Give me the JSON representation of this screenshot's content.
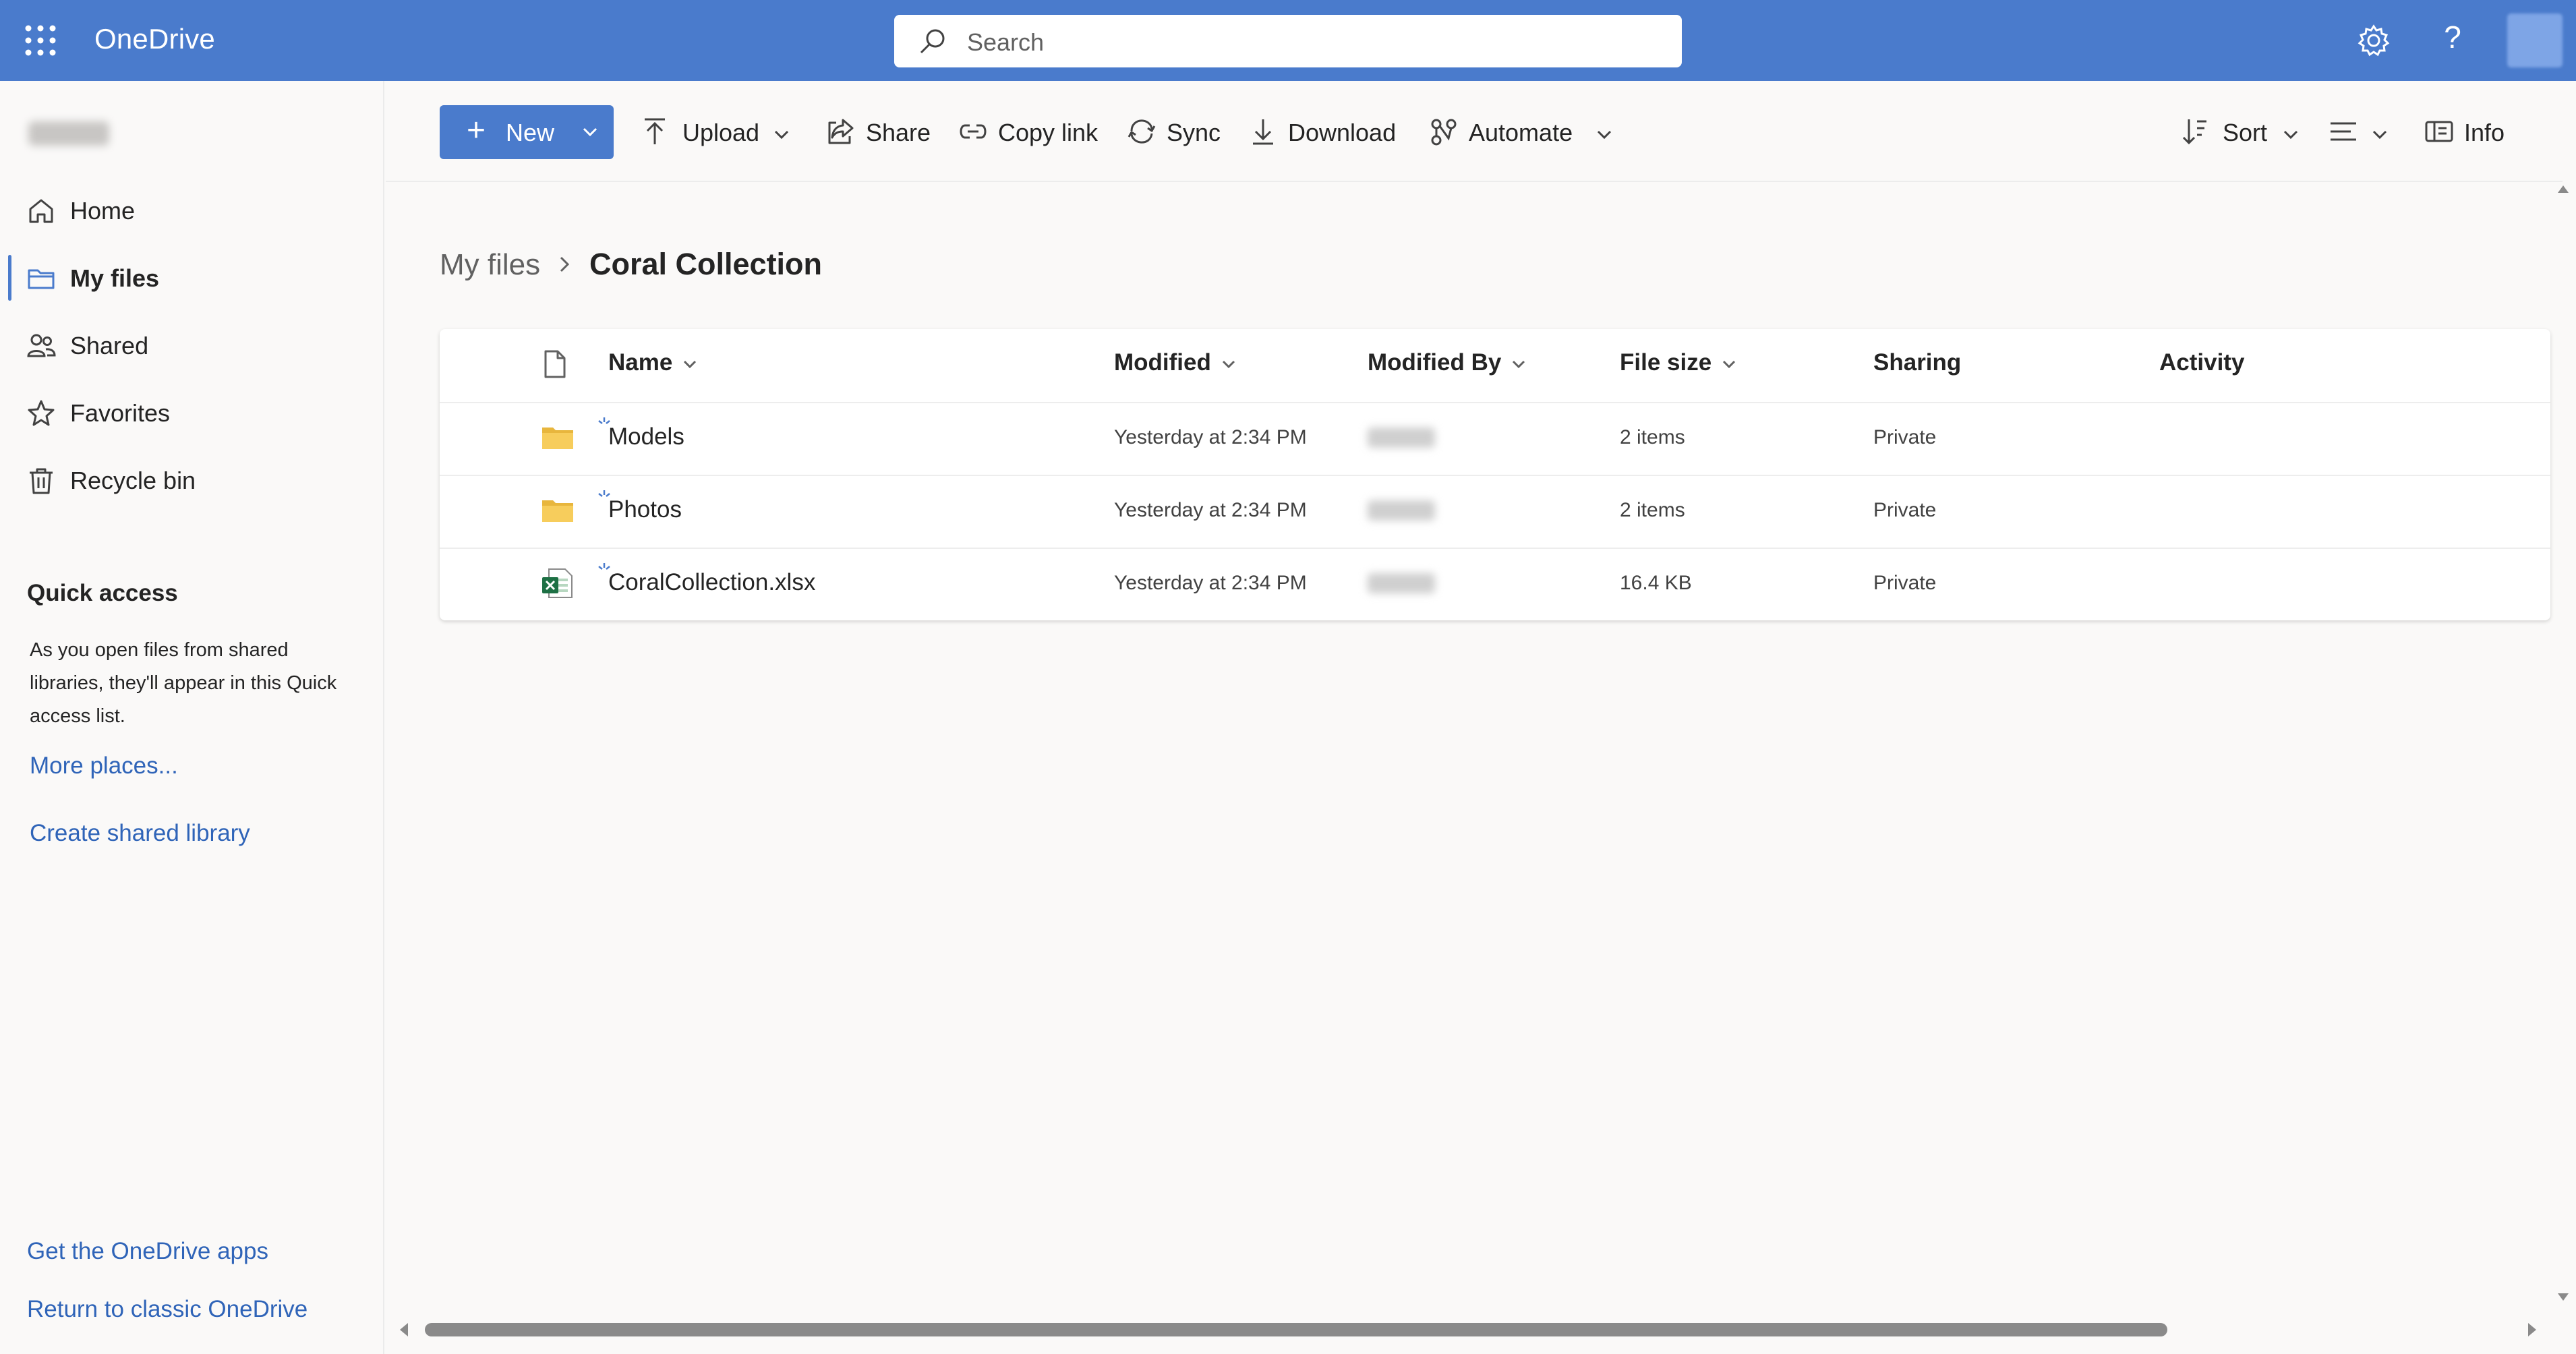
{
  "app": {
    "title": "OneDrive",
    "accent": "#4a7bcc"
  },
  "search": {
    "placeholder": "Search"
  },
  "header": {
    "help_label": "?"
  },
  "sidebar": {
    "items": [
      {
        "label": "Home",
        "icon": "home-icon"
      },
      {
        "label": "My files",
        "icon": "folder-icon",
        "active": true
      },
      {
        "label": "Shared",
        "icon": "people-icon"
      },
      {
        "label": "Favorites",
        "icon": "star-icon"
      },
      {
        "label": "Recycle bin",
        "icon": "trash-icon"
      }
    ],
    "quick_access": {
      "title": "Quick access",
      "description": "As you open files from shared libraries, they'll appear in this Quick access list.",
      "more_places": "More places...",
      "create_library": "Create shared library"
    },
    "footer": {
      "get_apps": "Get the OneDrive apps",
      "classic": "Return to classic OneDrive"
    }
  },
  "toolbar": {
    "new_plus": "+",
    "new_label": "New",
    "upload_label": "Upload",
    "share_label": "Share",
    "copy_link_label": "Copy link",
    "sync_label": "Sync",
    "download_label": "Download",
    "automate_label": "Automate",
    "sort_label": "Sort",
    "info_label": "Info"
  },
  "breadcrumb": {
    "root": "My files",
    "current": "Coral Collection"
  },
  "table": {
    "headers": {
      "name": "Name",
      "modified": "Modified",
      "modified_by": "Modified By",
      "file_size": "File size",
      "sharing": "Sharing",
      "activity": "Activity"
    },
    "rows": [
      {
        "name": "Models",
        "type": "folder",
        "modified": "Yesterday at 2:34 PM",
        "size": "2 items",
        "sharing": "Private"
      },
      {
        "name": "Photos",
        "type": "folder",
        "modified": "Yesterday at 2:34 PM",
        "size": "2 items",
        "sharing": "Private"
      },
      {
        "name": "CoralCollection.xlsx",
        "type": "excel",
        "modified": "Yesterday at 2:34 PM",
        "size": "16.4 KB",
        "sharing": "Private"
      }
    ]
  }
}
